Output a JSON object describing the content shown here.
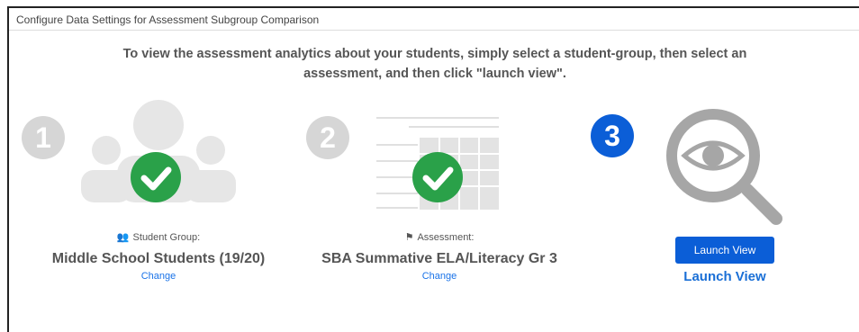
{
  "panel": {
    "title": "Configure Data Settings for Assessment Subgroup Comparison",
    "instructions_line1": "To view the assessment analytics about your students, simply select a student-group, then select an",
    "instructions_line2": "assessment, and then click \"launch view\"."
  },
  "steps": [
    {
      "number": "1",
      "caption": "Student Group:",
      "value": "Middle School Students (19/20)",
      "change": "Change",
      "icon": "users-icon"
    },
    {
      "number": "2",
      "caption": "Assessment:",
      "value": "SBA Summative ELA/Literacy Gr 3",
      "change": "Change",
      "icon": "flag-icon"
    },
    {
      "number": "3",
      "button": "Launch View",
      "link": "Launch View",
      "icon": "magnifier-eye-icon"
    }
  ],
  "colors": {
    "accent_blue": "#0b5ed7",
    "check_green": "#2aa149",
    "badge_grey": "#d6d6d6",
    "illustration_grey": "#e6e6e6"
  }
}
